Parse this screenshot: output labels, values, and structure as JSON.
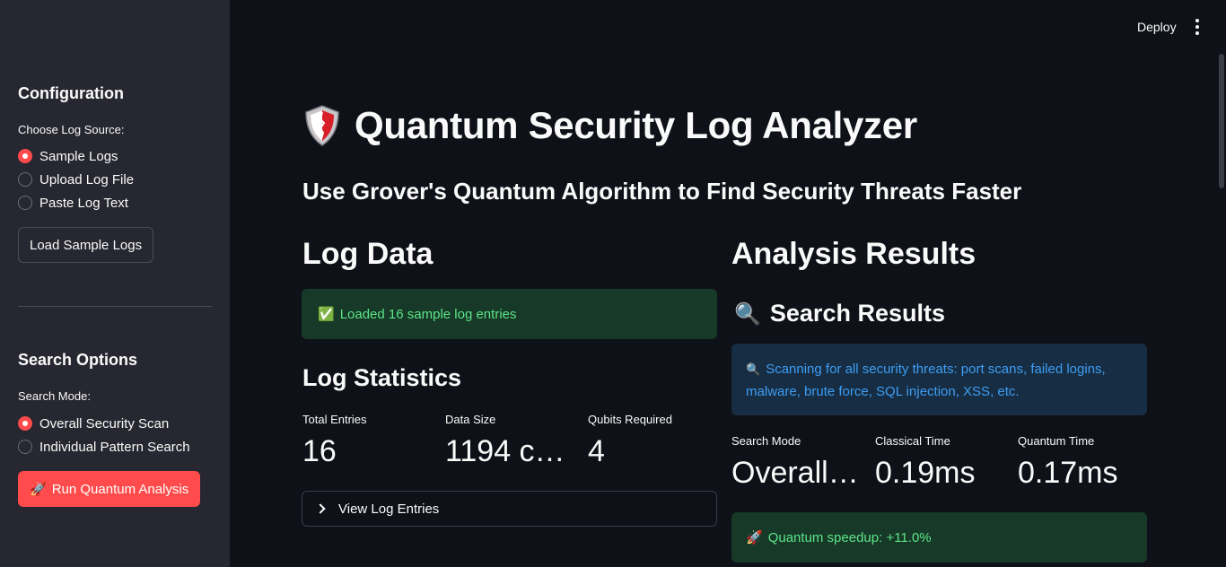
{
  "header": {
    "deploy_label": "Deploy",
    "menu_icon": "kebab-menu-icon"
  },
  "sidebar": {
    "configuration_heading": "Configuration",
    "log_source_label": "Choose Log Source:",
    "log_source_options": [
      {
        "label": "Sample Logs",
        "checked": true
      },
      {
        "label": "Upload Log File",
        "checked": false
      },
      {
        "label": "Paste Log Text",
        "checked": false
      }
    ],
    "load_button": "Load Sample Logs",
    "search_options_heading": "Search Options",
    "search_mode_label": "Search Mode:",
    "search_mode_options": [
      {
        "label": "Overall Security Scan",
        "checked": true
      },
      {
        "label": "Individual Pattern Search",
        "checked": false
      }
    ],
    "run_button": {
      "icon": "🚀",
      "label": "Run Quantum Analysis"
    }
  },
  "main": {
    "title_icon": "shield-icon",
    "title": "Quantum Security Log Analyzer",
    "subtitle": "Use Grover's Quantum Algorithm to Find Security Threats Faster",
    "log_data": {
      "heading": "Log Data",
      "success": {
        "icon": "✅",
        "text": "Loaded 16 sample log entries"
      },
      "stats_heading": "Log Statistics",
      "metrics": [
        {
          "label": "Total Entries",
          "value": "16"
        },
        {
          "label": "Data Size",
          "value": "1194 c…"
        },
        {
          "label": "Qubits Required",
          "value": "4"
        }
      ],
      "expander_label": "View Log Entries"
    },
    "analysis": {
      "heading": "Analysis Results",
      "search_results_heading": {
        "icon": "🔍",
        "text": "Search Results"
      },
      "info": {
        "icon": "🔍",
        "text": "Scanning for all security threats: port scans, failed logins, malware, brute force, SQL injection, XSS, etc."
      },
      "metrics": [
        {
          "label": "Search Mode",
          "value": "Overall…"
        },
        {
          "label": "Classical Time",
          "value": "0.19ms"
        },
        {
          "label": "Quantum Time",
          "value": "0.17ms"
        }
      ],
      "speedup": {
        "icon": "🚀",
        "text": "Quantum speedup: +11.0%"
      }
    }
  },
  "colors": {
    "background": "#0e1117",
    "sidebar": "#262730",
    "primary": "#ff4b4b",
    "success_bg": "#173928",
    "success_text": "#5ce488",
    "info_bg": "#172d43",
    "info_text": "#3d9df3"
  }
}
